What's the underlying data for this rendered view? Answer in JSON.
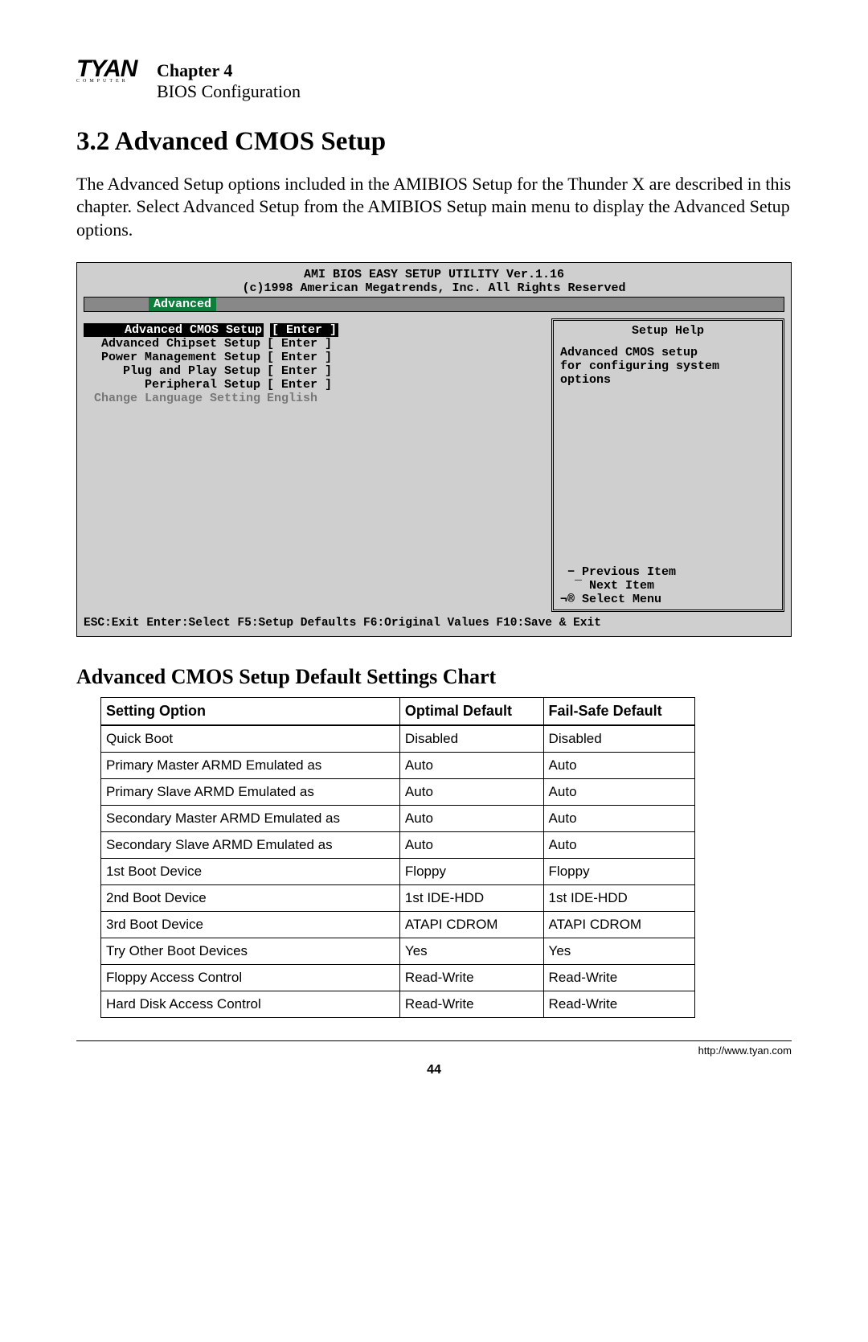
{
  "header": {
    "logo_main": "TYAN",
    "logo_sub": "COMPUTER",
    "chapter": "Chapter 4",
    "subtitle": "BIOS Configuration"
  },
  "section": {
    "number_title": "3.2 Advanced CMOS Setup",
    "intro": "The Advanced Setup options included in the AMIBIOS Setup for the Thunder X are described in this chapter. Select Advanced Setup from the AMIBIOS Setup main menu to display the Advanced Setup options."
  },
  "bios": {
    "title1": "AMI BIOS EASY SETUP UTILITY Ver.1.16",
    "title2": "(c)1998 American Megatrends, Inc.  All Rights Reserved",
    "tab": "Advanced",
    "menu": [
      {
        "label": "Advanced CMOS Setup",
        "value": "[ Enter ]",
        "selected": true,
        "dim": false
      },
      {
        "label": "Advanced Chipset Setup",
        "value": "[ Enter ]",
        "selected": false,
        "dim": false
      },
      {
        "label": "Power Management Setup",
        "value": "[ Enter ]",
        "selected": false,
        "dim": false
      },
      {
        "label": "Plug and Play Setup",
        "value": "[ Enter ]",
        "selected": false,
        "dim": false
      },
      {
        "label": "Peripheral Setup",
        "value": "[ Enter ]",
        "selected": false,
        "dim": false
      },
      {
        "label": "Change Language Setting",
        "value": "English",
        "selected": false,
        "dim": true
      }
    ],
    "help": {
      "title": "Setup Help",
      "lines": [
        "Advanced CMOS setup",
        "for configuring system",
        "options"
      ],
      "nav": [
        " − Previous Item",
        "  ¯ Next Item",
        "¬® Select Menu"
      ]
    },
    "footer": "ESC:Exit  Enter:Select  F5:Setup Defaults  F6:Original Values  F10:Save & Exit"
  },
  "table": {
    "title": "Advanced CMOS Setup Default Settings Chart",
    "headers": [
      "Setting Option",
      "Optimal Default",
      "Fail-Safe Default"
    ],
    "rows": [
      [
        "Quick Boot",
        "Disabled",
        "Disabled"
      ],
      [
        "Primary Master ARMD Emulated as",
        "Auto",
        "Auto"
      ],
      [
        "Primary Slave ARMD Emulated as",
        "Auto",
        "Auto"
      ],
      [
        "Secondary Master ARMD Emulated as",
        "Auto",
        "Auto"
      ],
      [
        "Secondary Slave ARMD Emulated as",
        "Auto",
        "Auto"
      ],
      [
        "1st Boot Device",
        "Floppy",
        "Floppy"
      ],
      [
        "2nd Boot Device",
        "1st IDE-HDD",
        "1st IDE-HDD"
      ],
      [
        "3rd Boot Device",
        "ATAPI CDROM",
        "ATAPI CDROM"
      ],
      [
        "Try Other Boot Devices",
        "Yes",
        "Yes"
      ],
      [
        "Floppy Access Control",
        "Read-Write",
        "Read-Write"
      ],
      [
        "Hard Disk Access Control",
        "Read-Write",
        "Read-Write"
      ]
    ]
  },
  "footer": {
    "url": "http://www.tyan.com",
    "page": "44"
  }
}
